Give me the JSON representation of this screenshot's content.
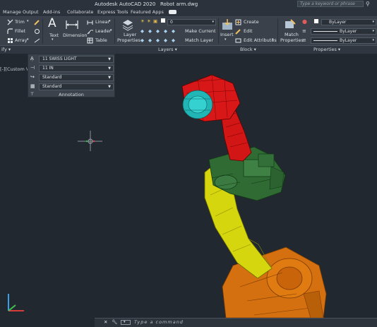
{
  "titlebar": {
    "app_title": "Autodesk AutoCAD 2020",
    "file_name": "Robot arm.dwg",
    "search_placeholder": "Type a keyword or phrase"
  },
  "menu_tabs": [
    "Manage",
    "Output",
    "Add-ins",
    "Collaborate",
    "Express Tools",
    "Featured Apps"
  ],
  "ribbon": {
    "modify": {
      "trim": "Trim",
      "fillet": "Fillet",
      "array": "Array"
    },
    "annotation": {
      "text": "Text",
      "dimension": "Dimension",
      "linear": "Linear",
      "leader": "Leader",
      "table": "Table"
    },
    "layers": {
      "layer_properties_line1": "Layer",
      "layer_properties_line2": "Properties",
      "current_layer": "0",
      "make_current": "Make Current",
      "match_layer": "Match Layer"
    },
    "block": {
      "insert": "Insert",
      "create": "Create",
      "edit": "Edit",
      "edit_attributes": "Edit Attributes"
    },
    "properties": {
      "match_line1": "Match",
      "match_line2": "Properties",
      "color": "ByLayer",
      "linetype": "ByLayer",
      "lineweight": "ByLayer"
    },
    "panel_labels": {
      "modify_short": "ify ▾",
      "layers": "Layers ▾",
      "block": "Block ▾",
      "properties": "Properties ▾"
    }
  },
  "annotation_panel": {
    "text_style": "11 SWISS LIGHT",
    "dim_style": "11 IN",
    "leader_style": "Standard",
    "table_style": "Standard",
    "label": "Annotation"
  },
  "viewport": {
    "label": "[-][Custom View"
  },
  "command": {
    "placeholder": "Type a command"
  },
  "colors": {
    "accent_red": "#d41515",
    "cyan": "#29c5c5",
    "dark_green": "#2d6a32",
    "yellow": "#d4d40a",
    "orange": "#d46a10"
  }
}
